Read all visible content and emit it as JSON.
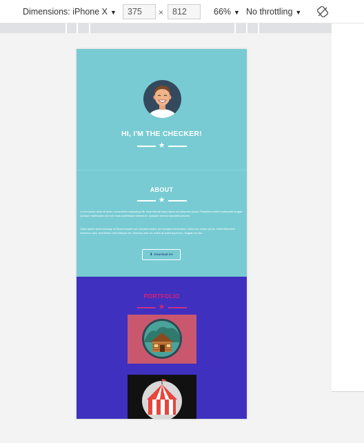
{
  "devtools": {
    "dimensions_label": "Dimensions: iPhone X",
    "width_value": "375",
    "height_value": "812",
    "times_sign": "×",
    "zoom": "66%",
    "throttling": "No throttling"
  },
  "hero": {
    "title": "HI, I'M THE CHECKER!"
  },
  "about": {
    "title": "ABOUT",
    "paragraph1": "Lorem ipsum dolor sit amet, consectetur adipiscing elit. Nam blandit turpis lacus sed pharetra auctor. Phasellus mattis malesuada feugiat. Quisque malesuada orci non risus scelerisque bibendum. Quisque viverra vulputate posuere.",
    "paragraph2": "Class aptent taciti sociosqu ad litora torquent per conubia nostra, per inceptos himenaeos. Nulla nec ornare purus. Nulla bibendum maximus urna, sed finibus velit tristique vel. Vivamus ante mi, mollis at scelerisque nec, feugiat non dui.",
    "download_label": "Download me"
  },
  "portfolio": {
    "title": "PORTFOLIO"
  },
  "icons": {
    "dropdown": "caret-down-icon",
    "rotate": "rotate-icon",
    "star": "star-icon",
    "download": "download-icon"
  },
  "colors": {
    "hero_bg": "#78cbd3",
    "portfolio_bg": "#4030c0",
    "portfolio_accent": "#e02070",
    "card1_bg": "#c9586f",
    "card2_bg": "#111111"
  }
}
